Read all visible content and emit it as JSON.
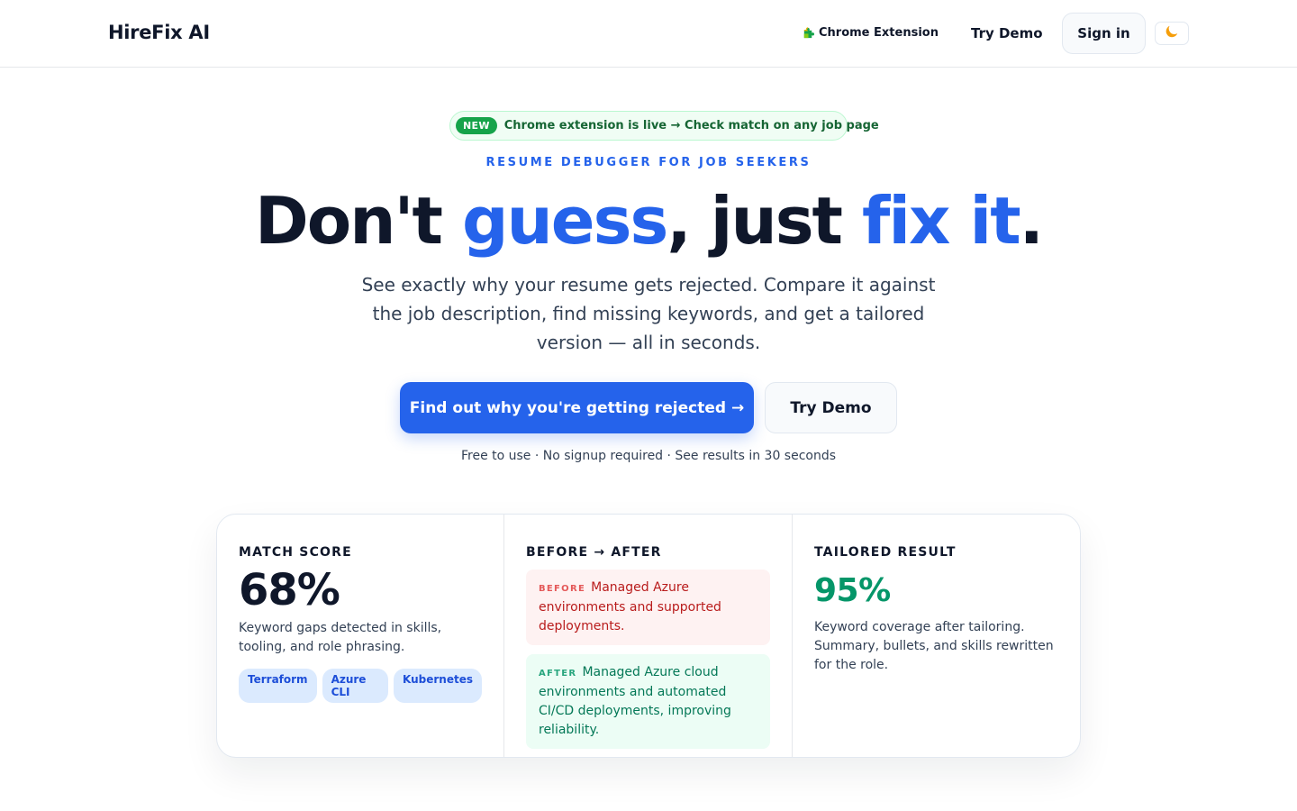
{
  "header": {
    "logo": "HireFix AI",
    "extension_label": "Chrome Extension",
    "try_demo_label": "Try Demo",
    "sign_in_label": "Sign in",
    "theme_icon": "moon-icon",
    "extension_icon": "puzzle-icon"
  },
  "hero": {
    "badge": "NEW",
    "announcement": "Chrome extension is live → Check match on any job page",
    "eyebrow": "RESUME DEBUGGER FOR JOB SEEKERS",
    "headline_part1": "Don't ",
    "headline_part2": "guess",
    "headline_part3": ", just ",
    "headline_part4": "fix it",
    "headline_part5": ".",
    "subtitle": "See exactly why your resume gets rejected. Compare it against the job description, find missing keywords, and get a tailored version — all in seconds.",
    "cta_primary": "Find out why you're getting rejected →",
    "cta_secondary": "Try Demo",
    "fineprint": "Free to use · No signup required · See results in 30 seconds"
  },
  "cards": {
    "match": {
      "title": "MATCH SCORE",
      "score": "68%",
      "description": "Keyword gaps detected in skills, tooling, and role phrasing.",
      "tags": [
        "Terraform",
        "Azure CLI",
        "Kubernetes"
      ]
    },
    "compare": {
      "title": "BEFORE → AFTER",
      "before_label": "BEFORE",
      "before_text": "Managed Azure environments and supported deployments.",
      "after_label": "AFTER",
      "after_text": "Managed Azure cloud environments and automated CI/CD deployments, improving reliability."
    },
    "tailored": {
      "title": "TAILORED RESULT",
      "score": "95%",
      "description": "Keyword coverage after tailoring. Summary, bullets, and skills rewritten for the role."
    }
  },
  "colors": {
    "accent": "#2563eb",
    "success": "#059669",
    "danger": "#b91c1c",
    "text": "#0f172a"
  }
}
